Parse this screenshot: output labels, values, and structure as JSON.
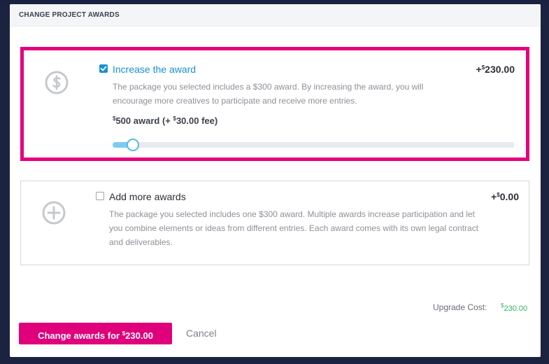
{
  "modal": {
    "title": "CHANGE PROJECT AWARDS"
  },
  "options": [
    {
      "title": "Increase the award",
      "selected": true,
      "price_prefix": "+",
      "price_currency": "$",
      "price_amount": "230.00",
      "description": "The package you selected includes a $300 award. By increasing the award, you will encourage more creatives to participate and receive more entries.",
      "icon": "dollar-circle-icon",
      "award_currency": "$",
      "award_text": "500 award (+ ",
      "fee_currency": "$",
      "fee_text": "30.00 fee)",
      "slider_value": 0.05
    },
    {
      "title": "Add more awards",
      "selected": false,
      "price_prefix": "+",
      "price_currency": "$",
      "price_amount": "0.00",
      "description": "The package you selected includes one $300 award. Multiple awards increase participation and let you combine elements or ideas from different entries. Each award comes with its own legal contract and deliverables.",
      "icon": "plus-circle-icon"
    }
  ],
  "summary": {
    "label": "Upgrade Cost:",
    "currency": "$",
    "amount": "230.00"
  },
  "actions": {
    "primary_prefix": "Change awards for ",
    "primary_currency": "$",
    "primary_amount": "230.00",
    "cancel": "Cancel"
  },
  "colors": {
    "accent_pink": "#e0007b",
    "link_blue": "#1592d8",
    "success_green": "#2db560"
  }
}
